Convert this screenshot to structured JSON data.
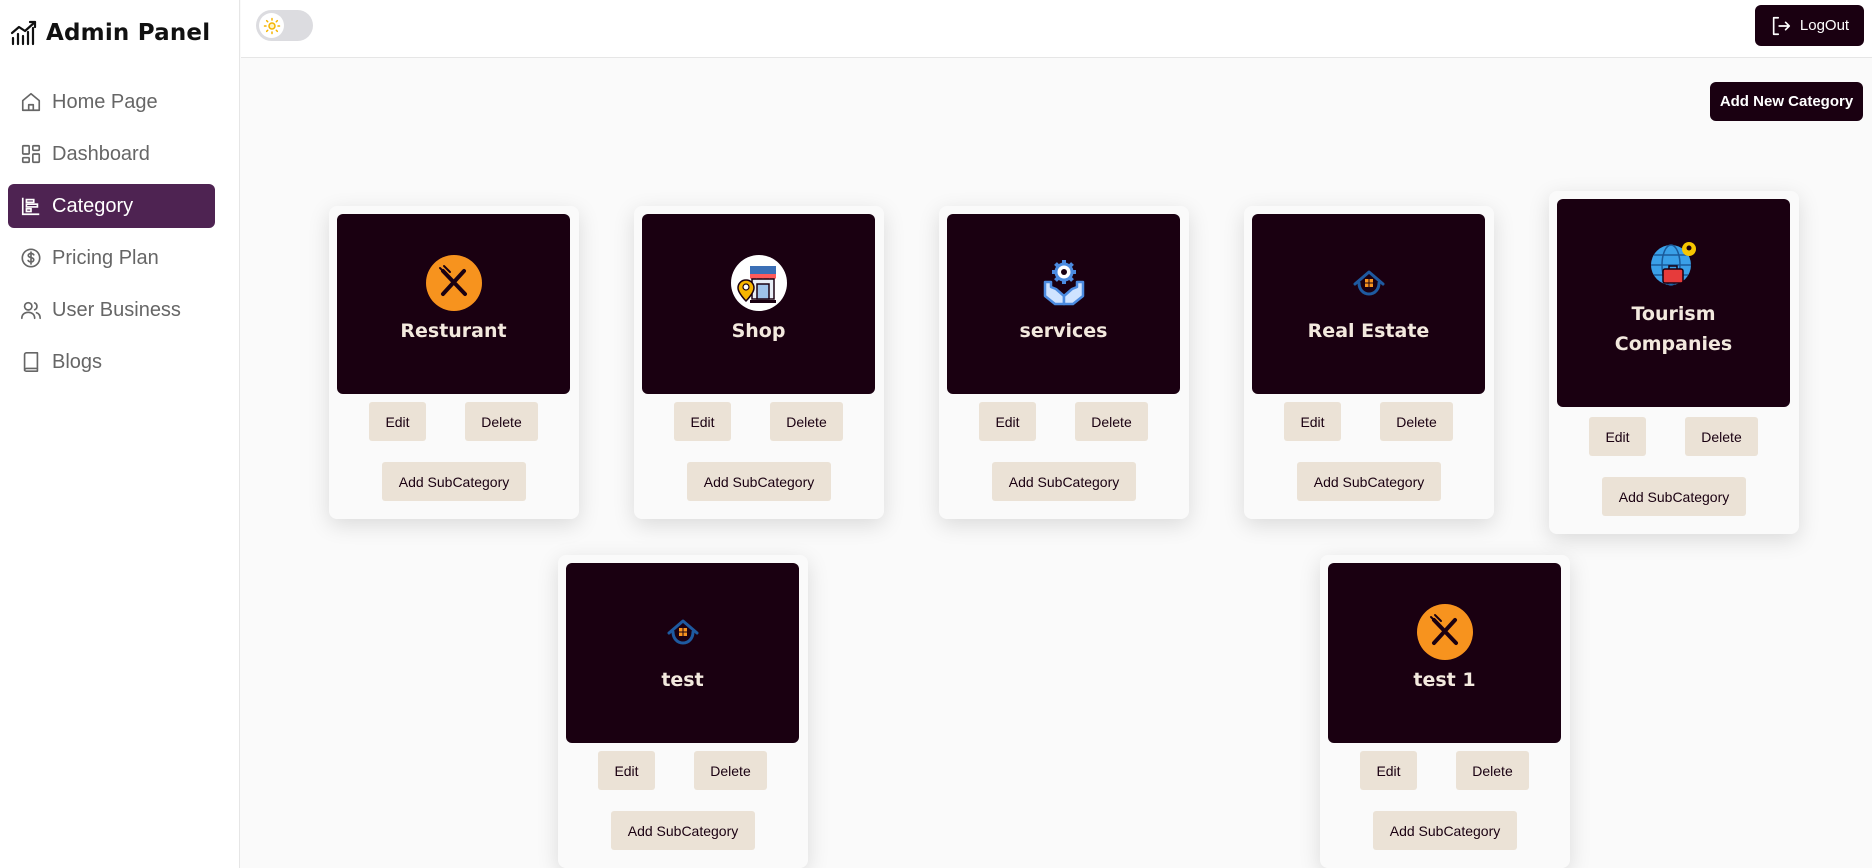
{
  "sidebar": {
    "brand": "Admin Panel",
    "items": [
      {
        "label": "Home Page",
        "icon": "home-icon",
        "active": false
      },
      {
        "label": "Dashboard",
        "icon": "dashboard-icon",
        "active": false
      },
      {
        "label": "Category",
        "icon": "category-icon",
        "active": true
      },
      {
        "label": "Pricing Plan",
        "icon": "dollar-icon",
        "active": false
      },
      {
        "label": "User Business",
        "icon": "users-icon",
        "active": false
      },
      {
        "label": "Blogs",
        "icon": "book-icon",
        "active": false
      }
    ]
  },
  "header": {
    "theme_toggle_icon": "sun-icon",
    "logout_label": "LogOut"
  },
  "actions": {
    "add_new_category": "Add New Category"
  },
  "cards": [
    {
      "title": "Resturant",
      "icon": "fork-knife-icon"
    },
    {
      "title": "Shop",
      "icon": "shop-icon"
    },
    {
      "title": "services",
      "icon": "gear-hands-icon"
    },
    {
      "title": "Real Estate",
      "icon": "house-icon"
    },
    {
      "title": "Tourism Companies",
      "icon": "globe-suitcase-icon"
    },
    {
      "title": "test",
      "icon": "house-icon"
    },
    {
      "title": "test 1",
      "icon": "fork-knife-icon"
    }
  ],
  "card_buttons": {
    "edit": "Edit",
    "delete": "Delete",
    "add_subcategory": "Add SubCategory"
  },
  "colors": {
    "primary_dark": "#1a0011",
    "active_nav": "#4e2352",
    "button_beige": "#ebe2d6",
    "card_title": "#f3e9de",
    "icon_orange": "#f7931e"
  }
}
